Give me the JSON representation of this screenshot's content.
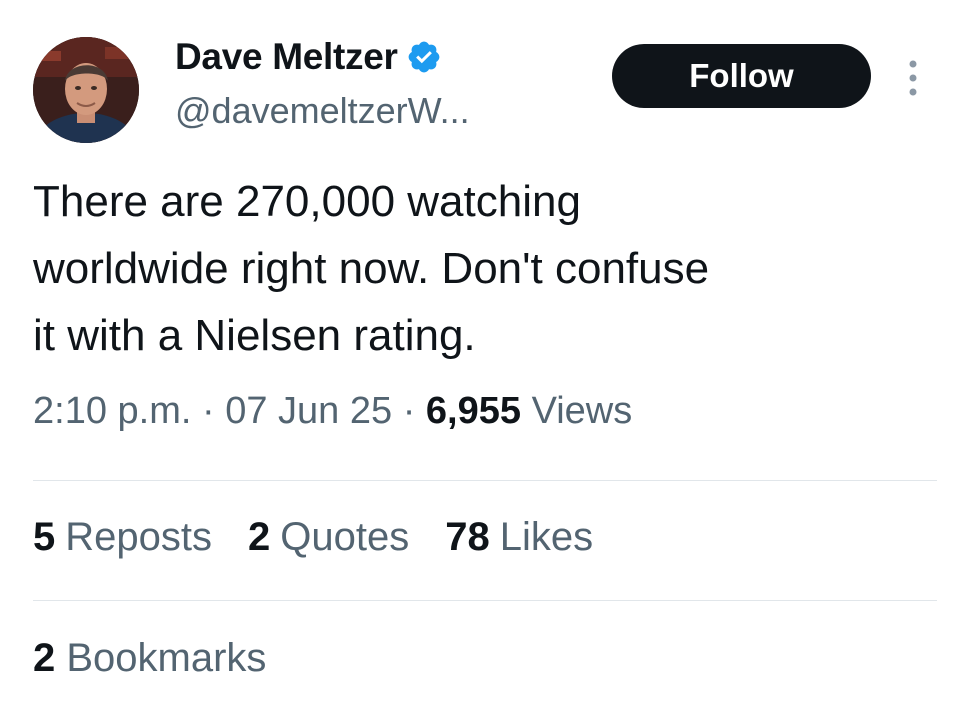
{
  "author": {
    "display_name": "Dave Meltzer",
    "handle": "@davemeltzerW...",
    "verified": true
  },
  "follow_button": {
    "label": "Follow"
  },
  "tweet": {
    "text": "There are 270,000 watching\nworldwide right now.  Don't confuse\nit with a Nielsen rating.",
    "time": "2:10 p.m.",
    "date": "07 Jun 25",
    "views_count": "6,955",
    "views_label": "Views",
    "separator": "·"
  },
  "stats": {
    "reposts": {
      "count": "5",
      "label": "Reposts"
    },
    "quotes": {
      "count": "2",
      "label": "Quotes"
    },
    "likes": {
      "count": "78",
      "label": "Likes"
    },
    "bookmarks": {
      "count": "2",
      "label": "Bookmarks"
    }
  },
  "colors": {
    "text_primary": "#0f1419",
    "text_secondary": "#536471",
    "verified_blue": "#1d9bf0",
    "follow_bg": "#0f1419",
    "divider": "#e1e6ea"
  },
  "icons": {
    "verified": "verified-badge-icon",
    "more": "more-options-icon"
  }
}
